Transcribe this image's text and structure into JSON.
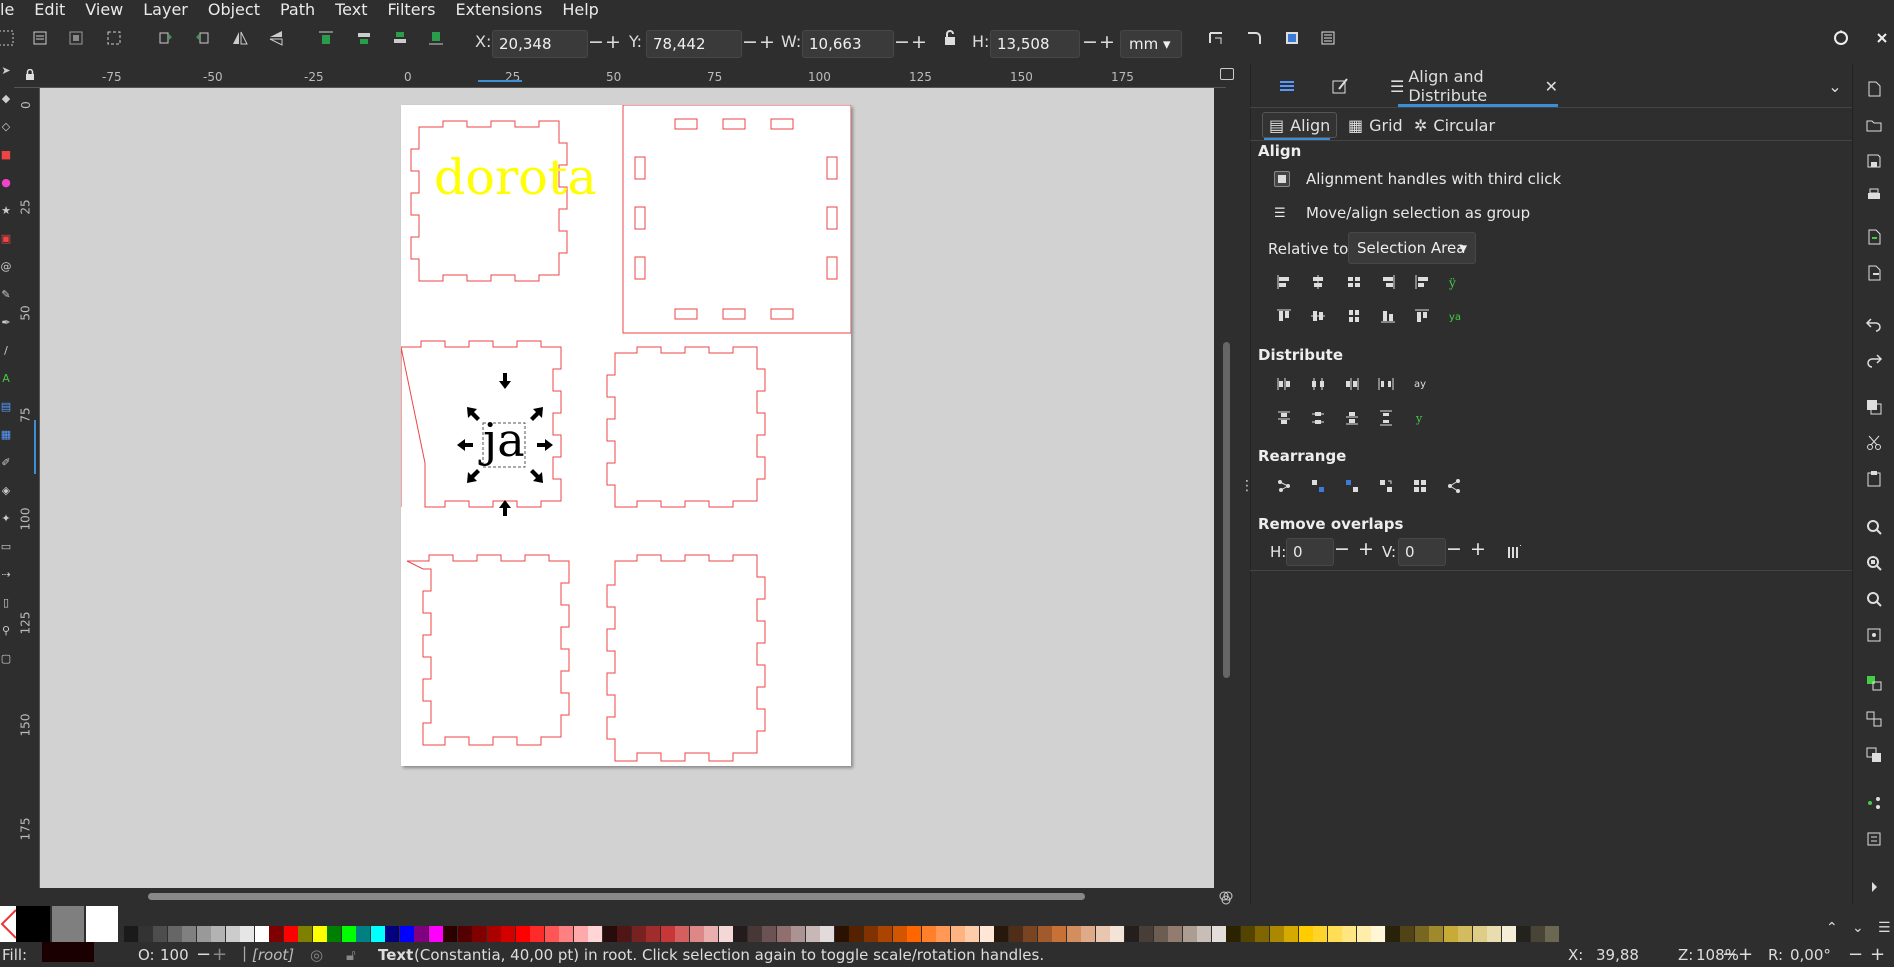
{
  "menu": [
    "le",
    "Edit",
    "View",
    "Layer",
    "Object",
    "Path",
    "Text",
    "Filters",
    "Extensions",
    "Help"
  ],
  "toolbar": {
    "x_label": "X:",
    "x_value": "20,348",
    "y_label": "Y:",
    "y_value": "78,442",
    "w_label": "W:",
    "w_value": "10,663",
    "h_label": "H:",
    "h_value": "13,508",
    "unit": "mm"
  },
  "ruler": {
    "h_ticks": [
      "-75",
      "-50",
      "-25",
      "0",
      "25",
      "50",
      "75",
      "100",
      "125",
      "150",
      "175"
    ],
    "v_ticks": [
      "0",
      "25",
      "50",
      "75",
      "100",
      "125",
      "150",
      "175"
    ]
  },
  "canvas": {
    "text_dorota": "dorota",
    "text_ja": "ja",
    "text_dorota_color": "#ffff00",
    "outline_color": "#ee4444"
  },
  "dock": {
    "tab_title": "Align and Distribute",
    "subtabs": [
      "Align",
      "Grid",
      "Circular"
    ],
    "align_heading": "Align",
    "opt_handles": "Alignment handles with third click",
    "opt_group": "Move/align selection as group",
    "relative_label": "Relative to:",
    "relative_value": "Selection Area",
    "distribute_heading": "Distribute",
    "rearrange_heading": "Rearrange",
    "remove_overlaps_heading": "Remove overlaps",
    "h_label": "H:",
    "h_value": "0",
    "v_label": "V:",
    "v_value": "0"
  },
  "status": {
    "fill_label": "Fill:",
    "opacity_label": "O:",
    "opacity_value": "100",
    "layer": "[root]",
    "message_type": "Text",
    "message": "(Constantia, 40,00 pt) in root. Click selection again to toggle scale/rotation handles.",
    "cursor_x_label": "X:",
    "cursor_x": "39,88",
    "zoom_label": "Z:",
    "zoom": "108%",
    "rotate_label": "R:",
    "rotate": "0,00°"
  },
  "palette_colors": [
    "#1a1a1a",
    "#333333",
    "#4d4d4d",
    "#666666",
    "#808080",
    "#999999",
    "#b3b3b3",
    "#cccccc",
    "#e6e6e6",
    "#ffffff",
    "#800000",
    "#ff0000",
    "#808000",
    "#ffff00",
    "#008000",
    "#00ff00",
    "#008080",
    "#00ffff",
    "#000080",
    "#0000ff",
    "#800080",
    "#ff00ff",
    "#2b0000",
    "#550000",
    "#800000",
    "#aa0000",
    "#d40000",
    "#ff0000",
    "#ff2a2a",
    "#ff5555",
    "#ff8080",
    "#ffaaaa",
    "#ffd5d5",
    "#280b0b",
    "#501616",
    "#782121",
    "#a02c2c",
    "#c83737",
    "#d35f5f",
    "#de8787",
    "#e9afaf",
    "#f4d7d7",
    "#241c1c",
    "#483737",
    "#6c5353",
    "#916f6f",
    "#ac9393",
    "#c8b7b7",
    "#e3dbdb",
    "#2b1100",
    "#552200",
    "#803300",
    "#aa4400",
    "#d45500",
    "#ff6600",
    "#ff7f2a",
    "#ff9955",
    "#ffb380",
    "#ffccaa",
    "#ffe6d5",
    "#28170b",
    "#502d16",
    "#784421",
    "#a05a2c",
    "#c87137",
    "#d38d5f",
    "#deaa87",
    "#e9c6af",
    "#f4e3d7",
    "#241f1c",
    "#483e37",
    "#6c5d53",
    "#917c6f",
    "#ac9d93",
    "#c8beb7",
    "#e3dedb",
    "#2b2200",
    "#554400",
    "#806600",
    "#aa8800",
    "#d4aa00",
    "#ffcc00",
    "#ffd42a",
    "#ffdd55",
    "#ffe680",
    "#ffeeaa",
    "#fff6d5",
    "#28220b",
    "#504416",
    "#786721",
    "#a0892c",
    "#c8ab37",
    "#d3bc5f",
    "#decd87",
    "#e9ddaf",
    "#f4eed7",
    "#24221c",
    "#484537",
    "#6c6753"
  ]
}
